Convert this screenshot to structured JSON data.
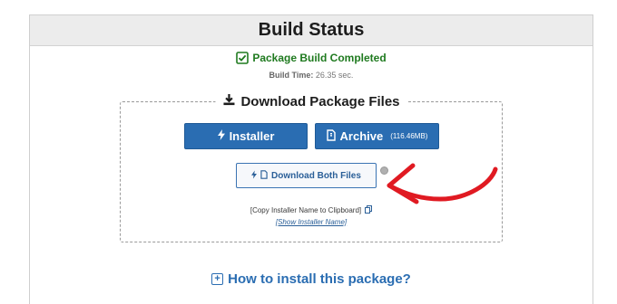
{
  "panel": {
    "title": "Build Status"
  },
  "status": {
    "message": "Package Build Completed",
    "build_time_label": "Build Time:",
    "build_time_value": "26.35 sec."
  },
  "download": {
    "legend": "Download Package Files",
    "installer_label": "Installer",
    "archive_label": "Archive",
    "archive_size": "(116.46MB)",
    "both_label": "Download Both Files",
    "copy_link": "[Copy Installer Name to Clipboard]",
    "show_link": "[Show Installer Name]"
  },
  "howto": {
    "label": "How to install this package?"
  },
  "colors": {
    "accent": "#2a6db2",
    "success": "#1f7a1f",
    "annotation_arrow": "#e01a22"
  },
  "icons": {
    "status": "check-square-icon",
    "legend": "download-icon",
    "installer": "bolt-icon",
    "archive": "file-zip-icon",
    "copy": "copy-icon",
    "howto": "plus-square-icon"
  }
}
